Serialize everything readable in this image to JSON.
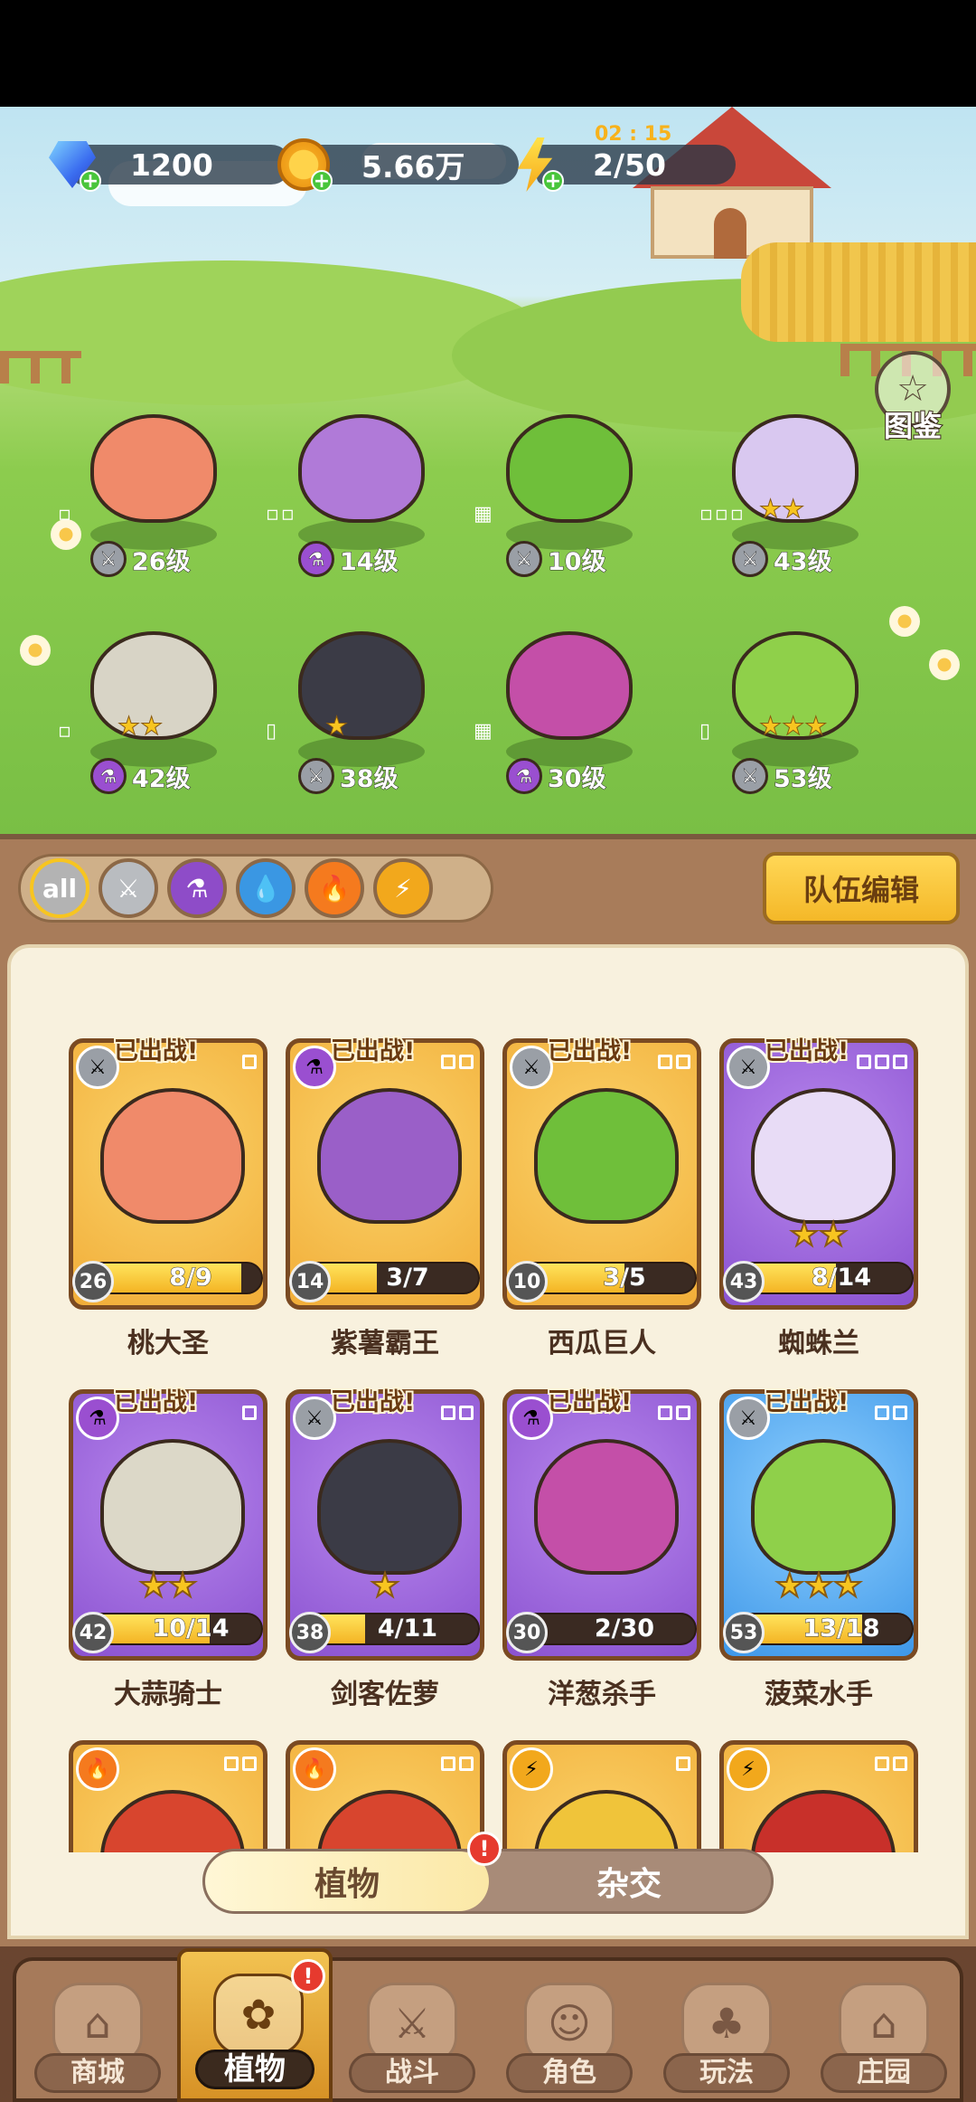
{
  "hud": {
    "gems": "1200",
    "coins": "5.66万",
    "energy": "2/50",
    "energy_timer": "02 : 15"
  },
  "atlas_label": "图鉴",
  "lineup": [
    {
      "level": "26级",
      "element": "sword",
      "stars": "",
      "slots": "▫",
      "color": "#f08a6a"
    },
    {
      "level": "14级",
      "element": "potion",
      "stars": "",
      "slots": "▫▫",
      "color": "#b07ad8"
    },
    {
      "level": "10级",
      "element": "sword",
      "stars": "",
      "slots": "▦",
      "color": "#6fbf3a"
    },
    {
      "level": "43级",
      "element": "sword",
      "stars": "★★",
      "slots": "▫▫▫",
      "color": "#d9c8f0"
    },
    {
      "level": "42级",
      "element": "potion",
      "stars": "★★",
      "slots": "▫",
      "color": "#d8d4c6"
    },
    {
      "level": "38级",
      "element": "sword",
      "stars": "★",
      "slots": "▯",
      "color": "#3b3b46"
    },
    {
      "level": "30级",
      "element": "potion",
      "stars": "",
      "slots": "▦",
      "color": "#c44fa8"
    },
    {
      "level": "53级",
      "element": "sword",
      "stars": "★★★",
      "slots": "▯",
      "color": "#8fd04a"
    }
  ],
  "filters": [
    {
      "id": "all",
      "label": "all"
    },
    {
      "id": "sword",
      "label": ""
    },
    {
      "id": "potion",
      "label": ""
    },
    {
      "id": "water",
      "label": ""
    },
    {
      "id": "fire",
      "label": ""
    },
    {
      "id": "bolt",
      "label": ""
    }
  ],
  "team_edit_label": "队伍编辑",
  "deployed_label": "已出战!",
  "cards": [
    {
      "name": "桃大圣",
      "level": "26",
      "count": "8/9",
      "progress": 0.89,
      "frame": "gold",
      "element": "sword",
      "stars": "",
      "slots": 1,
      "portrait": "#f08a6a"
    },
    {
      "name": "紫薯霸王",
      "level": "14",
      "count": "3/7",
      "progress": 0.43,
      "frame": "gold",
      "element": "potion",
      "stars": "",
      "slots": 2,
      "portrait": "#9a5fc8"
    },
    {
      "name": "西瓜巨人",
      "level": "10",
      "count": "3/5",
      "progress": 0.6,
      "frame": "gold",
      "element": "sword",
      "stars": "",
      "slots": 4,
      "portrait": "#6fbf3a"
    },
    {
      "name": "蜘蛛兰",
      "level": "43",
      "count": "8/14",
      "progress": 0.57,
      "frame": "purple",
      "element": "sword",
      "stars": "★★",
      "slots": 3,
      "portrait": "#e8dcf6"
    },
    {
      "name": "大蒜骑士",
      "level": "42",
      "count": "10/14",
      "progress": 0.71,
      "frame": "purple",
      "element": "potion",
      "stars": "★★",
      "slots": 1,
      "portrait": "#dcd8c8"
    },
    {
      "name": "剑客佐萝",
      "level": "38",
      "count": "4/11",
      "progress": 0.36,
      "frame": "purple",
      "element": "sword",
      "stars": "★",
      "slots": 2,
      "portrait": "#3b3b46"
    },
    {
      "name": "洋葱杀手",
      "level": "30",
      "count": "2/30",
      "progress": 0.07,
      "frame": "purple",
      "element": "potion",
      "stars": "",
      "slots": 4,
      "portrait": "#c44fa8"
    },
    {
      "name": "菠菜水手",
      "level": "53",
      "count": "13/18",
      "progress": 0.72,
      "frame": "blue",
      "element": "sword",
      "stars": "★★★",
      "slots": 2,
      "portrait": "#8fd04a"
    },
    {
      "name": "",
      "level": "",
      "count": "",
      "progress": 0,
      "frame": "gold",
      "element": "fire",
      "stars": "",
      "slots": 2,
      "portrait": "#d8452e"
    },
    {
      "name": "",
      "level": "",
      "count": "",
      "progress": 0,
      "frame": "gold",
      "element": "fire",
      "stars": "",
      "slots": 4,
      "portrait": "#d8452e"
    },
    {
      "name": "",
      "level": "",
      "count": "",
      "progress": 0,
      "frame": "gold",
      "element": "bolt",
      "stars": "",
      "slots": 1,
      "portrait": "#f0c43a"
    },
    {
      "name": "",
      "level": "",
      "count": "",
      "progress": 0,
      "frame": "gold",
      "element": "bolt",
      "stars": "",
      "slots": 4,
      "portrait": "#c8302a"
    }
  ],
  "segment": {
    "active": "植物",
    "inactive": "杂交",
    "alert": "!"
  },
  "nav": [
    {
      "label": "商城",
      "icon": "shop-icon",
      "glyph": "⌂"
    },
    {
      "label": "植物",
      "icon": "plants-icon",
      "glyph": "✿",
      "active": true,
      "alert": "!"
    },
    {
      "label": "战斗",
      "icon": "battle-icon",
      "glyph": "⚔"
    },
    {
      "label": "角色",
      "icon": "character-icon",
      "glyph": "☺"
    },
    {
      "label": "玩法",
      "icon": "gameplay-icon",
      "glyph": "♣"
    },
    {
      "label": "庄园",
      "icon": "manor-icon",
      "glyph": "⌂"
    }
  ],
  "colors": {
    "gold_card": "#f1ad38",
    "purple_card": "#8a52d0",
    "blue_card": "#3e97e8",
    "wood": "#a87c5a",
    "accent": "#f4b828"
  }
}
